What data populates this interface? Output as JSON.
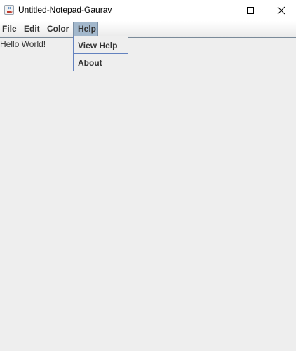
{
  "window": {
    "title": "Untitled-Notepad-Gaurav",
    "icon": "java-cup-icon",
    "controls": [
      "minimize-icon",
      "maximize-icon",
      "close-icon"
    ]
  },
  "menubar": {
    "items": [
      {
        "label": "File"
      },
      {
        "label": "Edit"
      },
      {
        "label": "Color"
      },
      {
        "label": "Help"
      }
    ],
    "open_menu": "Help"
  },
  "help_menu": {
    "items": [
      {
        "label": "View Help"
      },
      {
        "label": "About"
      }
    ]
  },
  "editor": {
    "content": "Hello World!"
  },
  "colors": {
    "background": "#eeeeee",
    "menu_highlight": "#a3b8cc",
    "dropdown_border": "#6382bf",
    "text": "#333333"
  }
}
